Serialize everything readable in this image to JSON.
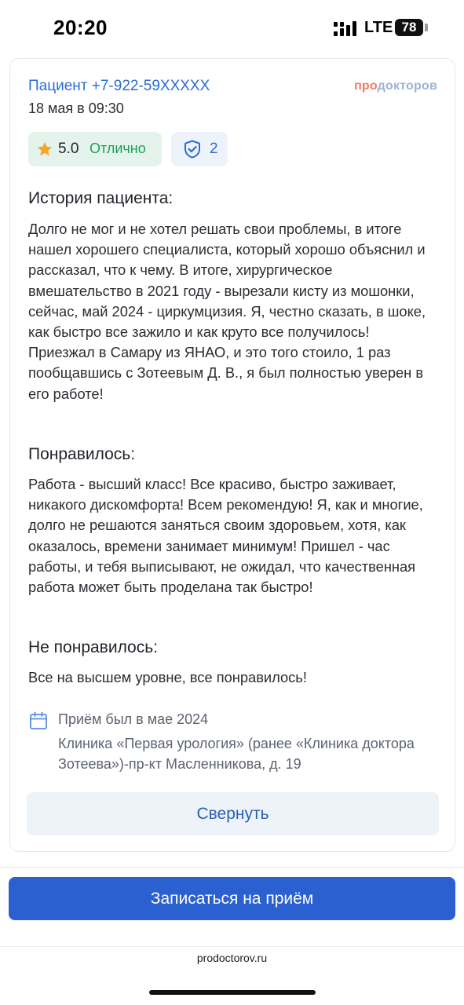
{
  "status_bar": {
    "time": "20:20",
    "network": "LTE",
    "battery": "78",
    "icons": [
      "signal-icon",
      "battery-icon"
    ]
  },
  "review": {
    "author": "Пациент +7-922-59XXXXX",
    "brand_pro": "про",
    "brand_rest": "докторов",
    "date": "18 мая в 09:30",
    "rating_value": "5.0",
    "rating_word": "Отлично",
    "verified_count": "2",
    "history_title": "История пациента:",
    "history_text": "Долго не мог и не хотел решать свои проблемы, в итоге нашел хорошего специалиста, который хорошо объяснил и рассказал, что к чему. В итоге, хирургическое вмешательство в 2021 году - вырезали кисту из мошонки, сейчас, май 2024 - циркумцизия. Я, честно сказать, в шоке, как быстро все зажило и как круто все получилось! Приезжал в Самару из ЯНАО, и это того стоило, 1 раз пообщавшись с Зотеевым Д. В., я был полностью уверен в его работе!",
    "liked_title": "Понравилось:",
    "liked_text": "Работа - высший класс! Все красиво, быстро заживает, никакого дискомфорта! Всем рекомендую! Я, как и многие, долго не решаются заняться своим здоровьем, хотя, как оказалось, времени занимает минимум! Пришел - час работы, и тебя выписывают, не ожидал, что качественная работа может быть проделана так быстро!",
    "disliked_title": "Не понравилось:",
    "disliked_text": "Все на высшем уровне, все понравилось!",
    "visit_date": "Приём был в мае 2024",
    "visit_clinic": "Клиника «Первая урология» (ранее «Клиника доктора Зотеева»)-пр-кт Масленникова, д. 19",
    "collapse_label": "Свернуть"
  },
  "footer": {
    "book_label": "Записаться на приём",
    "url": "prodoctorov.ru"
  },
  "colors": {
    "accent": "#2a60d0",
    "link": "#2b6cd6",
    "rating_bg": "#e4f4ec",
    "rating_text": "#1f9d5a",
    "star": "#f5a623"
  }
}
